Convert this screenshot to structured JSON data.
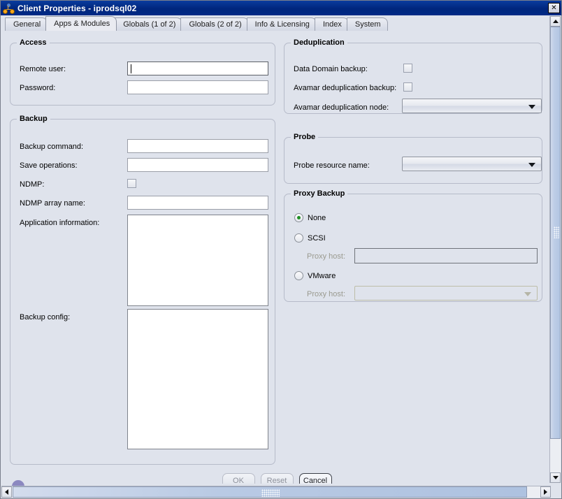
{
  "window": {
    "title": "Client Properties - iprodsql02",
    "icon": "network-node-icon",
    "close_label": "✕"
  },
  "tabs": [
    {
      "label": "General",
      "selected": false
    },
    {
      "label": "Apps & Modules",
      "selected": true
    },
    {
      "label": "Globals (1 of 2)",
      "selected": false
    },
    {
      "label": "Globals (2 of 2)",
      "selected": false
    },
    {
      "label": "Info & Licensing",
      "selected": false
    },
    {
      "label": "Index",
      "selected": false
    },
    {
      "label": "System",
      "selected": false
    }
  ],
  "access": {
    "legend": "Access",
    "remote_user_label": "Remote user:",
    "remote_user_value": "",
    "password_label": "Password:",
    "password_value": ""
  },
  "backup": {
    "legend": "Backup",
    "backup_command_label": "Backup command:",
    "backup_command_value": "",
    "save_operations_label": "Save operations:",
    "save_operations_value": "",
    "ndmp_label": "NDMP:",
    "ndmp_checked": false,
    "ndmp_array_name_label": "NDMP array name:",
    "ndmp_array_name_value": "",
    "application_information_label": "Application information:",
    "application_information_value": "",
    "backup_config_label": "Backup config:",
    "backup_config_value": ""
  },
  "deduplication": {
    "legend": "Deduplication",
    "data_domain_backup_label": "Data Domain backup:",
    "data_domain_backup_checked": false,
    "avamar_dedup_backup_label": "Avamar deduplication backup:",
    "avamar_dedup_backup_checked": false,
    "avamar_dedup_node_label": "Avamar deduplication node:",
    "avamar_dedup_node_value": ""
  },
  "probe": {
    "legend": "Probe",
    "probe_resource_name_label": "Probe resource name:",
    "probe_resource_name_value": ""
  },
  "proxy_backup": {
    "legend": "Proxy Backup",
    "selected": "None",
    "option_none": "None",
    "option_scsi": "SCSI",
    "option_vmware": "VMware",
    "scsi_proxy_host_label": "Proxy host:",
    "scsi_proxy_host_value": "",
    "vmware_proxy_host_label": "Proxy host:",
    "vmware_proxy_host_value": ""
  },
  "buttons": {
    "ok": "OK",
    "reset": "Reset",
    "cancel": "Cancel"
  },
  "colors": {
    "titlebar": "#00267d",
    "panel": "#dfe3ec",
    "radio_selected": "#1e8f23",
    "scrollbar_thumb": "#b9cae4"
  }
}
